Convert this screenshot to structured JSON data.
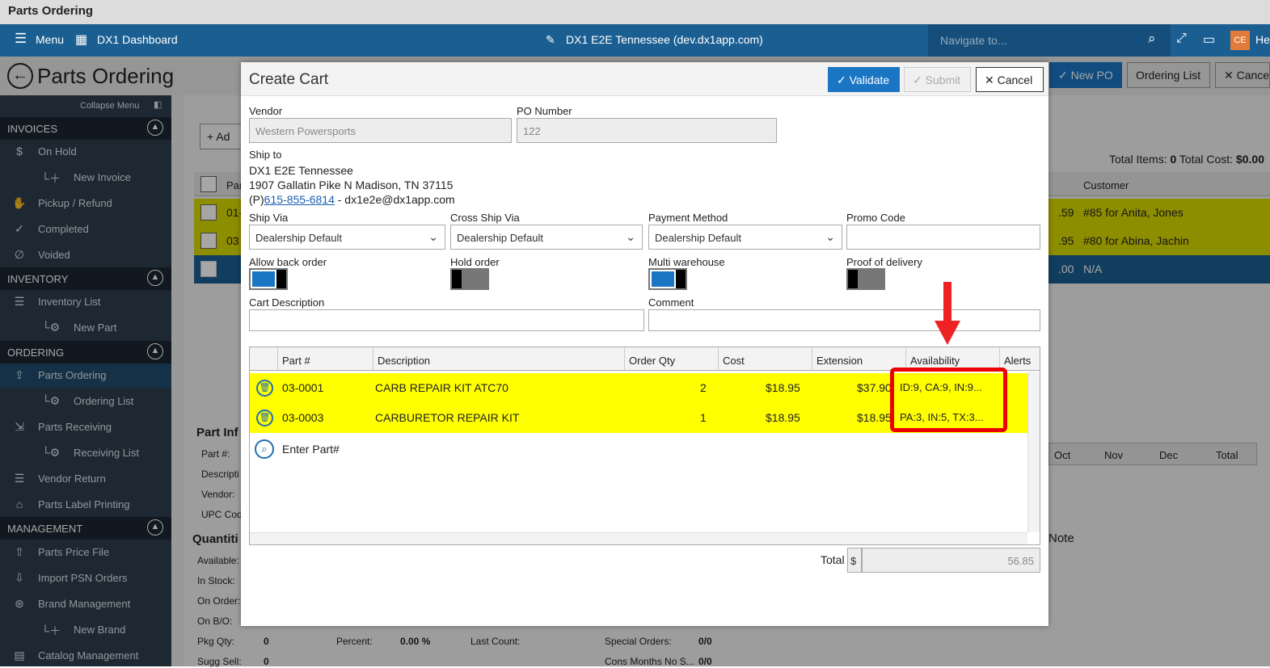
{
  "app": {
    "title": "Parts Ordering"
  },
  "topnav": {
    "menu": "Menu",
    "dashboard": "DX1 Dashboard",
    "site": "DX1 E2E Tennessee (dev.dx1app.com)",
    "navigate_placeholder": "Navigate to...",
    "avatar": "CE",
    "help": "He"
  },
  "page": {
    "title": "Parts Ordering",
    "buttons": {
      "new_po": "New PO",
      "ordering_list": "Ordering List",
      "cancel": "Cance"
    }
  },
  "sidebar": {
    "collapse": "Collapse Menu",
    "sections": [
      {
        "title": "INVOICES",
        "items": [
          "On Hold",
          "New Invoice",
          "Pickup / Refund",
          "Completed",
          "Voided"
        ]
      },
      {
        "title": "INVENTORY",
        "items": [
          "Inventory List",
          "New Part"
        ]
      },
      {
        "title": "ORDERING",
        "items": [
          "Parts Ordering",
          "Ordering List",
          "Parts Receiving",
          "Receiving List",
          "Vendor Return",
          "Parts Label Printing"
        ]
      },
      {
        "title": "MANAGEMENT",
        "items": [
          "Parts Price File",
          "Import PSN Orders",
          "Brand Management",
          "New Brand",
          "Catalog Management"
        ]
      }
    ]
  },
  "background": {
    "add_btn": "Ad",
    "total_items_label": "Total Items:",
    "total_items": "0",
    "total_cost_label": "Total Cost:",
    "total_cost": "$0.00",
    "customer_hdr": "Customer",
    "col_par": "Par",
    "rows": [
      {
        "code": "01-",
        "amount": ".59",
        "customer": "#85 for Anita, Jones"
      },
      {
        "code": "03",
        "amount": ".95",
        "customer": "#80 for Abina, Jachin"
      },
      {
        "code": "",
        "amount": ".00",
        "customer": "N/A"
      }
    ],
    "part_info": "Part Inf",
    "part_label": "Part #:",
    "desc_label": "Descripti",
    "vendor_label": "Vendor:",
    "upc_label": "UPC Cod",
    "quantities": "Quantiti",
    "available": "Available:",
    "instock": "In Stock:",
    "onorder": "On Order:",
    "onbo": "On B/O:",
    "pkgqty": "Pkg Qty:",
    "pkgqty_val": "0",
    "suggsell": "Sugg Sell:",
    "suggsell_val": "0",
    "percent": "Percent:",
    "percent_val": "0.00 %",
    "lastcount": "Last Count:",
    "special": "Special Orders:",
    "special_val": "0/0",
    "cons": "Cons Months No S...",
    "cons_val": "0/0",
    "months": [
      "Oct",
      "Nov",
      "Dec",
      "Total"
    ],
    "note": "Note"
  },
  "dialog": {
    "title": "Create Cart",
    "validate": "Validate",
    "submit": "Submit",
    "cancel": "Cancel",
    "vendor_label": "Vendor",
    "vendor": "Western Powersports",
    "po_label": "PO Number",
    "po": "122",
    "shipto_label": "Ship to",
    "shipto_name": "DX1 E2E Tennessee",
    "shipto_addr": "1907 Gallatin Pike N Madison, TN 37115",
    "phone_prefix": "(P)",
    "phone": "615-855-6814",
    "email": "- dx1e2e@dx1app.com",
    "shipvia_label": "Ship Via",
    "shipvia": "Dealership Default",
    "cross_label": "Cross Ship Via",
    "cross": "Dealership Default",
    "payment_label": "Payment Method",
    "payment": "Dealership Default",
    "promo_label": "Promo Code",
    "promo": "",
    "backorder_label": "Allow back order",
    "backorder_on": true,
    "hold_label": "Hold order",
    "hold_on": false,
    "multi_label": "Multi warehouse",
    "multi_on": true,
    "proof_label": "Proof of delivery",
    "proof_on": false,
    "cartdesc_label": "Cart Description",
    "comment_label": "Comment",
    "columns": [
      "Part #",
      "Description",
      "Order Qty",
      "Cost",
      "Extension",
      "Availability",
      "Alerts"
    ],
    "lines": [
      {
        "part": "03-0001",
        "desc": "CARB REPAIR KIT ATC70",
        "qty": "2",
        "cost": "$18.95",
        "ext": "$37.90",
        "avail": "ID:9, CA:9, IN:9..."
      },
      {
        "part": "03-0003",
        "desc": "CARBURETOR REPAIR KIT",
        "qty": "1",
        "cost": "$18.95",
        "ext": "$18.95",
        "avail": "PA:3, IN:5, TX:3..."
      }
    ],
    "enter_part": "Enter Part#",
    "total_label": "Total",
    "currency": "$",
    "total": "56.85"
  },
  "colors": {
    "nav": "#1b5f92",
    "highlight": "#ffff00",
    "accent": "#1a76c4",
    "annotation": "#e00000"
  }
}
